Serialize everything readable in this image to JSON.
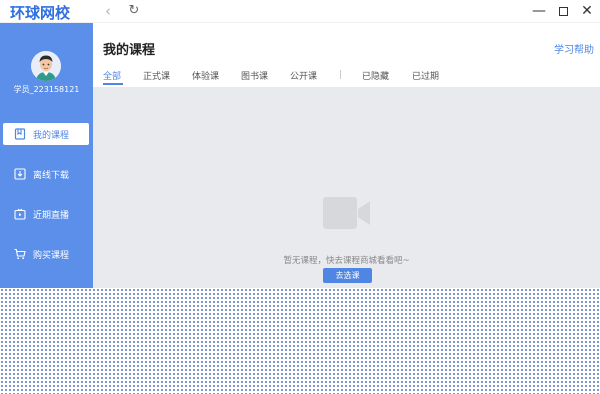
{
  "app": {
    "logo_text": "环球网校"
  },
  "titlebar": {
    "back_glyph": "‹",
    "refresh_glyph": "↻",
    "minimize_glyph": "—",
    "close_glyph": "✕"
  },
  "user": {
    "name": "学员_223158121"
  },
  "sidebar": {
    "items": [
      {
        "label": "我的课程",
        "icon": "bookmark-icon",
        "active": true
      },
      {
        "label": "离线下载",
        "icon": "download-icon",
        "active": false
      },
      {
        "label": "近期直播",
        "icon": "live-tv-icon",
        "active": false
      },
      {
        "label": "购买课程",
        "icon": "cart-icon",
        "active": false
      }
    ]
  },
  "header": {
    "title": "我的课程",
    "help": "学习帮助"
  },
  "tabs": [
    {
      "label": "全部",
      "active": true
    },
    {
      "label": "正式课",
      "active": false
    },
    {
      "label": "体验课",
      "active": false
    },
    {
      "label": "图书课",
      "active": false
    },
    {
      "label": "公开课",
      "active": false
    },
    {
      "label": "已隐藏",
      "active": false
    },
    {
      "label": "已过期",
      "active": false
    }
  ],
  "empty_state": {
    "icon": "video-camera-icon",
    "message": "暂无课程，快去课程商城看看吧~",
    "button": "去选课"
  },
  "colors": {
    "accent": "#4f86e4",
    "sidebar_bg": "#5b8fe9",
    "content_bg": "#e9eaee"
  }
}
